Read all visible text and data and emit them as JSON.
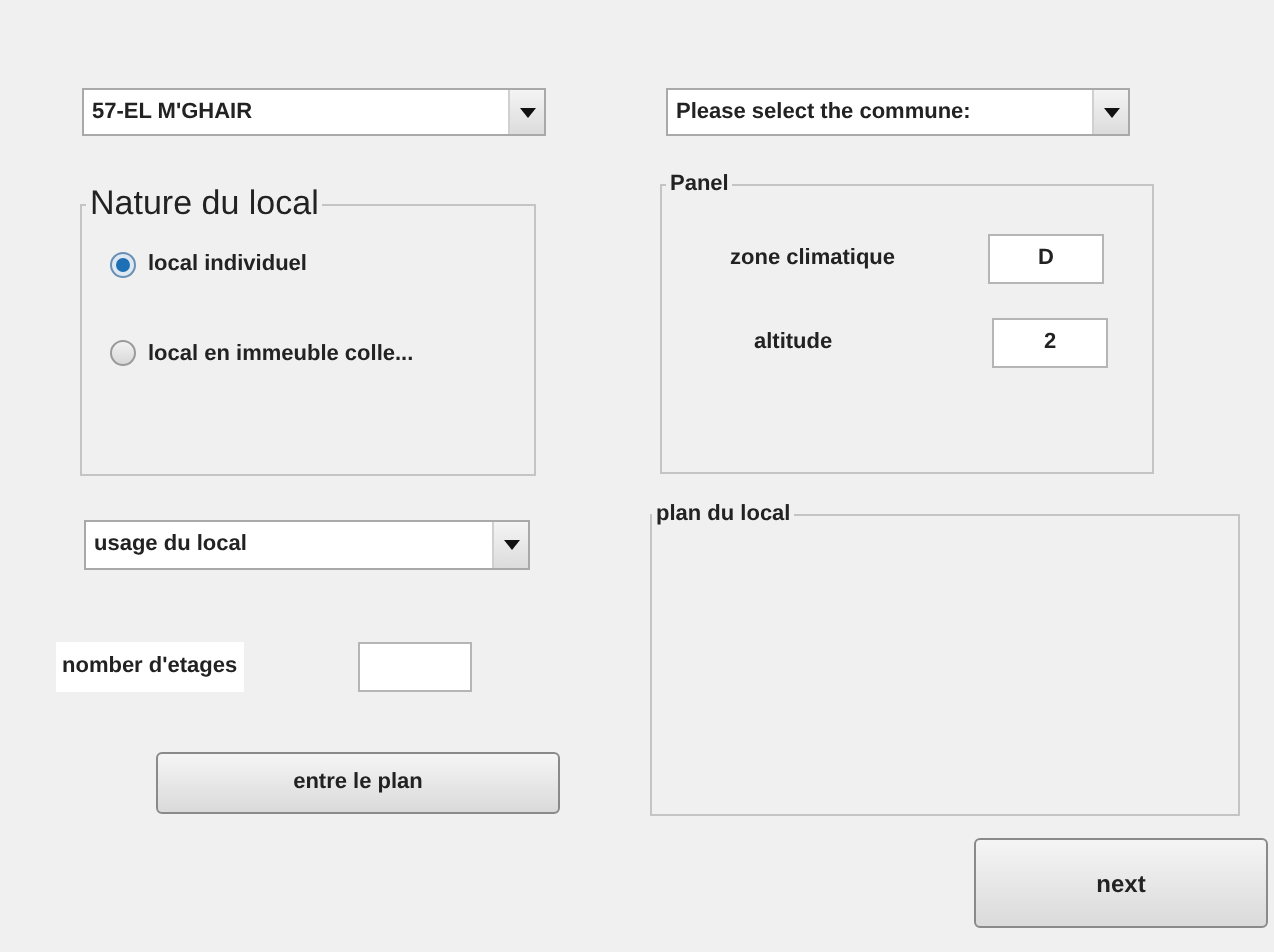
{
  "wilaya_dropdown": {
    "value": "57-EL M'GHAIR"
  },
  "nature_group": {
    "title": "Nature du local",
    "options": [
      {
        "label": "local individuel",
        "selected": true
      },
      {
        "label": "local en immeuble colle...",
        "selected": false
      }
    ]
  },
  "usage_dropdown": {
    "value": "usage du local"
  },
  "floors": {
    "label": "nomber d'etages"
  },
  "plan_button": "entre le plan",
  "commune_dropdown": {
    "value": "Please select the commune:"
  },
  "panel": {
    "title": "Panel",
    "fields": [
      {
        "label": "zone climatique",
        "value": "D"
      },
      {
        "label": "altitude",
        "value": "2"
      }
    ]
  },
  "plan_panel": {
    "title": "plan du local"
  },
  "next_button": "next"
}
